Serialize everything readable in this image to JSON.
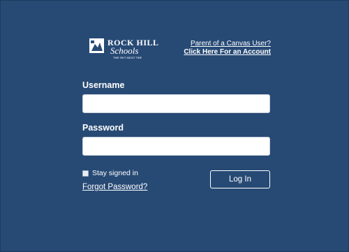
{
  "header": {
    "logo": {
      "name_line1": "ROCK HILL",
      "name_line2": "Schools",
      "tagline": "TIME ISN'T ABOUT TIME"
    },
    "parent_link_line1": "Parent of a Canvas User?",
    "parent_link_line2": "Click Here For an Account"
  },
  "form": {
    "username_label": "Username",
    "username_value": "",
    "password_label": "Password",
    "password_value": "",
    "remember_label": "Stay signed in",
    "remember_checked": false,
    "forgot_label": "Forgot Password?",
    "login_label": "Log In"
  },
  "colors": {
    "background": "#274a75",
    "text": "#ffffff",
    "input_background": "#ffffff"
  }
}
